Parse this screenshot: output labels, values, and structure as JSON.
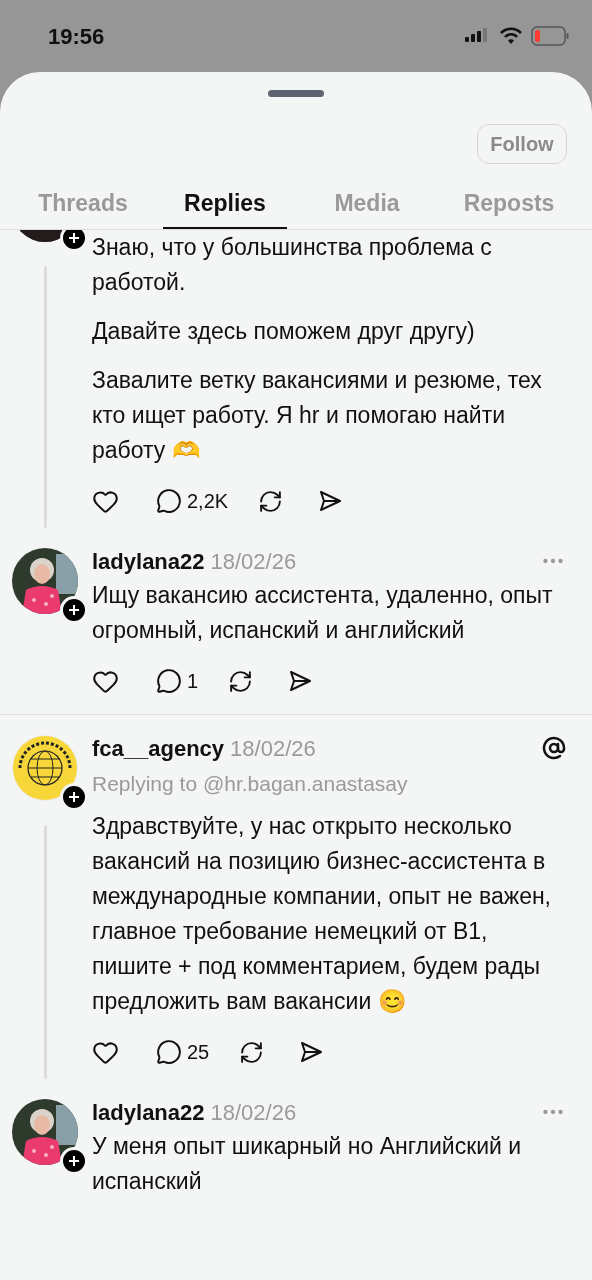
{
  "status_bar": {
    "time": "19:56"
  },
  "profile": {
    "follow_button": "Follow"
  },
  "tabs": [
    {
      "label": "Threads",
      "selected": false
    },
    {
      "label": "Replies",
      "selected": true
    },
    {
      "label": "Media",
      "selected": false
    },
    {
      "label": "Reposts",
      "selected": false
    }
  ],
  "thread_groups": [
    {
      "posts": [
        {
          "follow_badge": true,
          "paragraphs": [
            "Знаю, что у большинства проблема с работой.",
            "Давайте здесь поможем друг другу)",
            "Завалите ветку вакансиями и резюме, тех кто ищет работу. Я hr и помогаю найти работу 🫶"
          ],
          "reply_count": "2,2K",
          "actions": true
        },
        {
          "follow_badge": true,
          "user": "ladylana22",
          "date": "18/02/26",
          "more_menu": true,
          "threads_mark": false,
          "paragraphs": [
            "Ищу вакансию ассистента, удаленно, опыт огромный, испанский и английский"
          ],
          "reply_count": "1",
          "actions": true
        }
      ]
    },
    {
      "posts": [
        {
          "follow_badge": true,
          "user": "fca__agency",
          "date": "18/02/26",
          "more_menu": false,
          "threads_mark": true,
          "replying_to": "Replying to @hr.bagan.anastasay",
          "paragraphs": [
            "Здравствуйте, у нас открыто несколько вакансий на позицию бизнес-ассистента в международные компании, опыт не важен, главное требование немецкий от B1, пишите + под комментарием, будем рады предложить вам вакансии 😊"
          ],
          "reply_count": "25",
          "actions": true
        },
        {
          "follow_badge": true,
          "user": "ladylana22",
          "date": "18/02/26",
          "more_menu": true,
          "threads_mark": false,
          "paragraphs": [
            "У меня опыт шикарный но Английский и испанский"
          ],
          "actions": false
        }
      ]
    }
  ]
}
